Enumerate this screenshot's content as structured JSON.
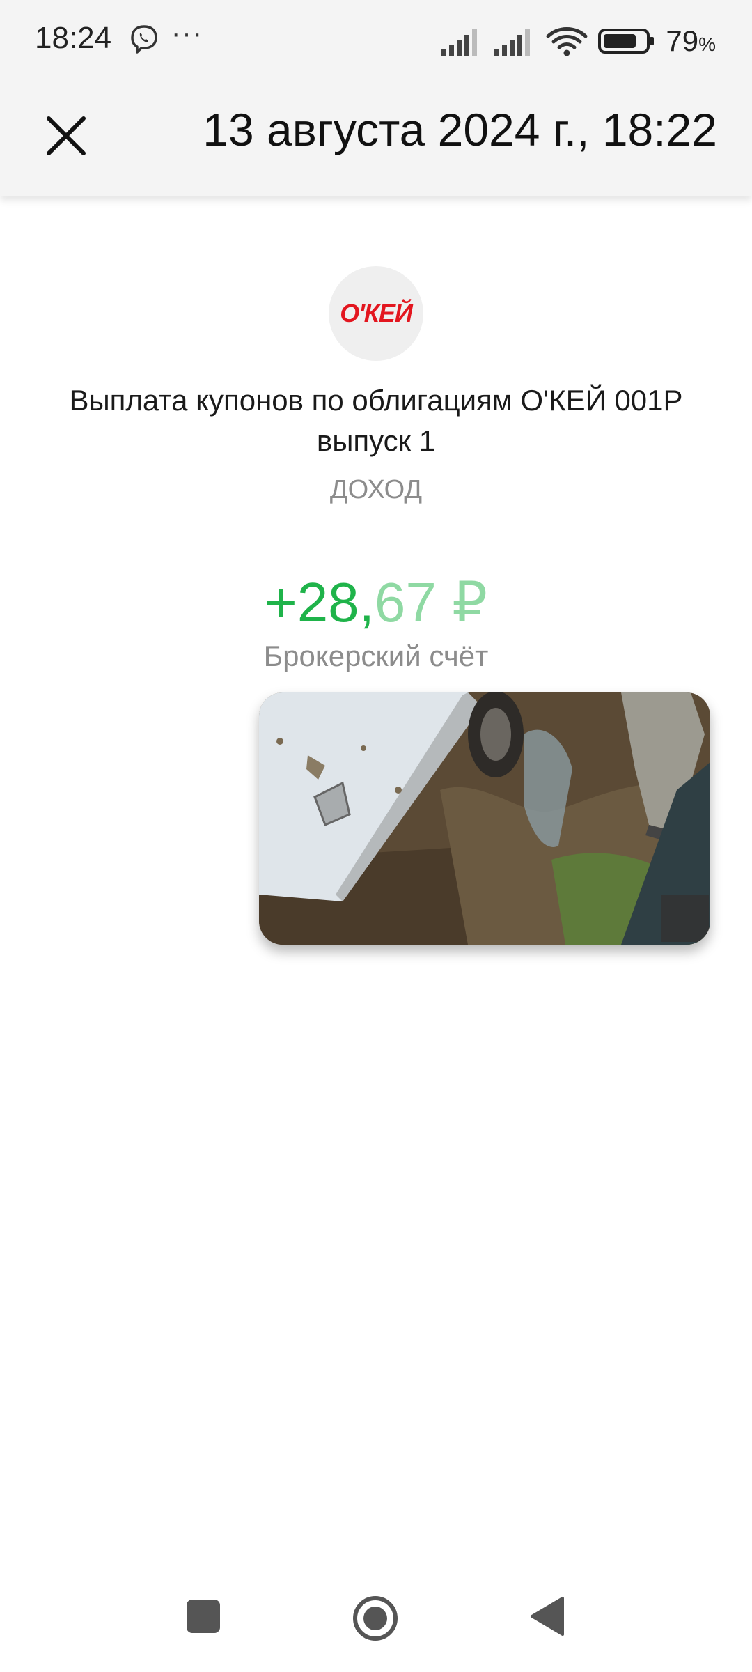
{
  "status_bar": {
    "time": "18:24",
    "more": "···",
    "battery_percent": "79",
    "battery_unit": "%",
    "battery_level": 0.79
  },
  "header": {
    "title": "13 августа 2024 г., 18:22"
  },
  "operation": {
    "logo_text": "О'КЕЙ",
    "title": "Выплата купонов по облигациям О'КЕЙ 001Р выпуск 1",
    "type": "ДОХОД",
    "amount_main": "+28,",
    "amount_fraction": "67 ₽",
    "account": "Брокерский счёт"
  },
  "colors": {
    "positive": "#1fb34a",
    "positive_light": "#8fd9a3",
    "brand_logo": "#e3161f"
  }
}
